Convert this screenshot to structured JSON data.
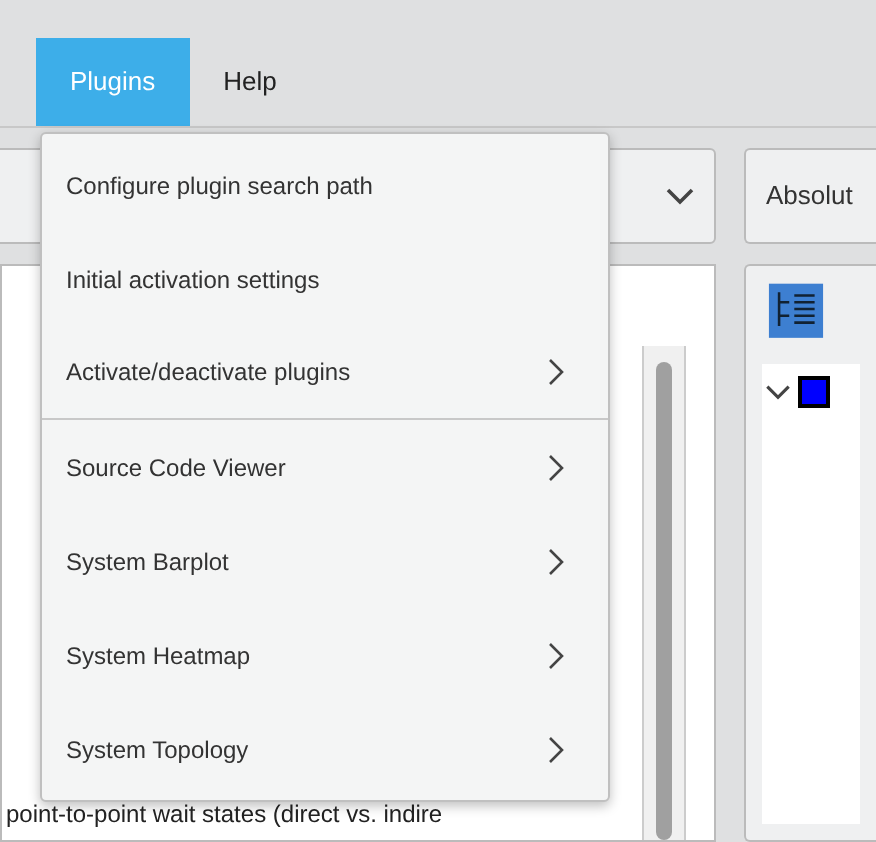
{
  "menubar": [
    {
      "label": "Plugins",
      "selected": true
    },
    {
      "label": "Help",
      "selected": false
    }
  ],
  "menu": {
    "items": [
      {
        "label": "Configure plugin search path",
        "submenu": false,
        "separator_after": false
      },
      {
        "label": "Initial activation settings",
        "submenu": false,
        "separator_after": false
      },
      {
        "label": "Activate/deactivate plugins",
        "submenu": true,
        "separator_after": true
      },
      {
        "label": "Source Code Viewer",
        "submenu": true,
        "separator_after": false
      },
      {
        "label": "System Barplot",
        "submenu": true,
        "separator_after": false
      },
      {
        "label": "System Heatmap",
        "submenu": true,
        "separator_after": false
      },
      {
        "label": "System Topology",
        "submenu": true,
        "separator_after": false
      }
    ]
  },
  "toolbar": {
    "button": "Absolut"
  },
  "list": {
    "rows": [
      {
        "label": "point-to-point wait states (direct vs. indire"
      }
    ]
  }
}
